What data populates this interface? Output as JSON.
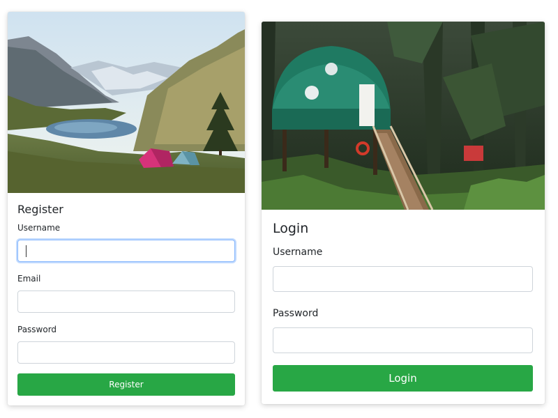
{
  "register": {
    "title": "Register",
    "username_label": "Username",
    "email_label": "Email",
    "password_label": "Password",
    "username_value": "",
    "email_value": "",
    "password_value": "",
    "button_label": "Register",
    "image": "mountain-lake-campsite-with-tents"
  },
  "login": {
    "title": "Login",
    "username_label": "Username",
    "password_label": "Password",
    "username_value": "",
    "password_value": "",
    "button_label": "Login",
    "image": "geodesic-dome-treehouse-in-forest"
  },
  "colors": {
    "button_bg": "#28a745",
    "focus_border": "#86b7fe",
    "input_border": "#ced4da",
    "text": "#212529"
  }
}
